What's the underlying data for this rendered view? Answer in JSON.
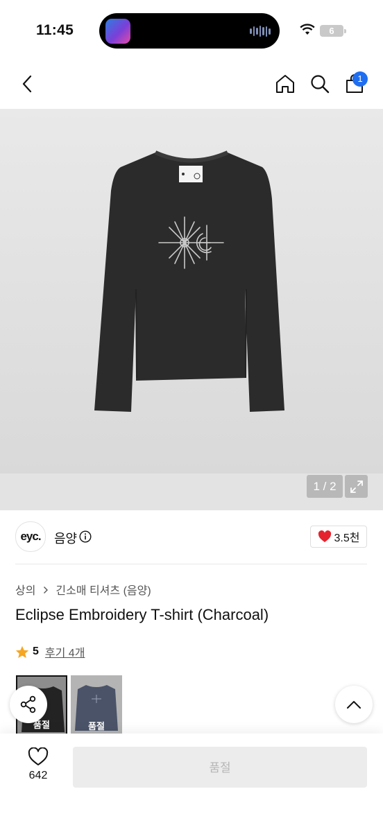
{
  "status_bar": {
    "time": "11:45",
    "battery": "6"
  },
  "nav": {
    "cart_count": "1"
  },
  "gallery": {
    "pager": "1 / 2"
  },
  "brand": {
    "logo_text": "eyc.",
    "name": "음양",
    "likes": "3.5천"
  },
  "product": {
    "breadcrumb": [
      "상의",
      "긴소매 티셔츠 (음양)"
    ],
    "title": "Eclipse Embroidery T-shirt (Charcoal)",
    "rating": "5",
    "reviews": "후기 4개"
  },
  "variants": [
    {
      "label": "품절"
    },
    {
      "label": "품절"
    }
  ],
  "bottom_bar": {
    "wish_count": "642",
    "buy_label": "품절"
  },
  "colors": {
    "accent": "#1f6ff0",
    "heart": "#e5232e",
    "star": "#f5a623"
  }
}
